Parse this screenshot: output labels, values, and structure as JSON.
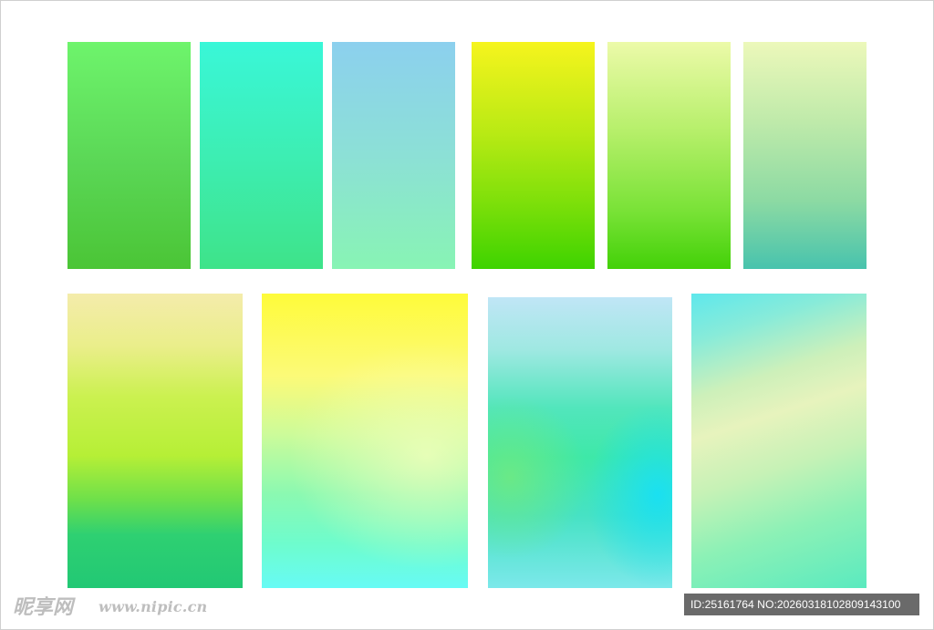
{
  "swatches": [
    {
      "id": "s1",
      "colors": [
        "#6ef46c",
        "#4bc536"
      ]
    },
    {
      "id": "s2",
      "colors": [
        "#39f7d8",
        "#3ee389"
      ]
    },
    {
      "id": "s3",
      "colors": [
        "#8cd0ee",
        "#88f4b4"
      ]
    },
    {
      "id": "s4",
      "colors": [
        "#f6f41d",
        "#3ed300"
      ]
    },
    {
      "id": "s5",
      "colors": [
        "#ecfaa9",
        "#43d108"
      ]
    },
    {
      "id": "s6",
      "colors": [
        "#ecf8ba",
        "#48c3ad"
      ]
    },
    {
      "id": "s7",
      "colors": [
        "#f4ecab",
        "#b6ef36",
        "#22c874"
      ]
    },
    {
      "id": "s8",
      "colors": [
        "#fefb3a",
        "#8bf9b1",
        "#67fbf5"
      ]
    },
    {
      "id": "s9",
      "colors": [
        "#c0e6f6",
        "#3ee8a8",
        "#18e0f4"
      ]
    },
    {
      "id": "s10",
      "colors": [
        "#5ee8ec",
        "#e7f3bd",
        "#5aeabf"
      ]
    }
  ],
  "watermark": {
    "logo_text": "昵享网",
    "site": "www.nipic.cn",
    "id_text": "ID:25161764 NO:20260318102809143100"
  }
}
